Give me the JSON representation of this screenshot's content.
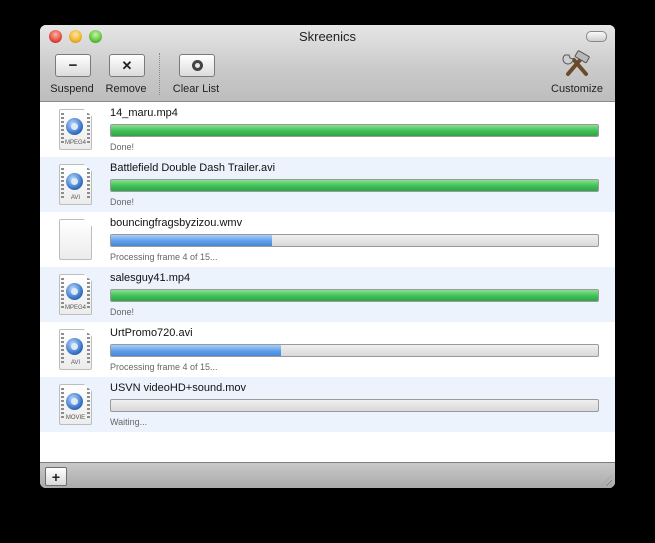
{
  "window": {
    "title": "Skreenics"
  },
  "toolbar": {
    "suspend_label": "Suspend",
    "remove_label": "Remove",
    "clear_label": "Clear List",
    "customize_label": "Customize",
    "suspend_glyph": "−",
    "remove_glyph": "✕"
  },
  "files": [
    {
      "name": "14_maru.mp4",
      "type": "MPEG4",
      "icon": "quicktime-file-icon",
      "progress": 1.0,
      "state": "done",
      "status": "Done!"
    },
    {
      "name": "Battlefield Double Dash Trailer.avi",
      "type": "AVI",
      "icon": "quicktime-file-icon",
      "progress": 1.0,
      "state": "done",
      "status": "Done!"
    },
    {
      "name": "bouncingfragsbyzizou.wmv",
      "type": "",
      "icon": "generic-file-icon",
      "progress": 0.33,
      "state": "processing",
      "status": "Processing frame 4 of 15..."
    },
    {
      "name": "salesguy41.mp4",
      "type": "MPEG4",
      "icon": "quicktime-file-icon",
      "progress": 1.0,
      "state": "done",
      "status": "Done!"
    },
    {
      "name": "UrtPromo720.avi",
      "type": "AVI",
      "icon": "quicktime-file-icon",
      "progress": 0.35,
      "state": "processing",
      "status": "Processing frame 4 of 15..."
    },
    {
      "name": "USVN videoHD+sound.mov",
      "type": "MOVIE",
      "icon": "quicktime-file-icon",
      "progress": 0.0,
      "state": "waiting",
      "status": "Waiting..."
    }
  ],
  "bottom": {
    "add_glyph": "+"
  },
  "colors": {
    "done": "#3fbf57",
    "processing": "#5e9ee9",
    "row_alt": "#edf3fd"
  }
}
